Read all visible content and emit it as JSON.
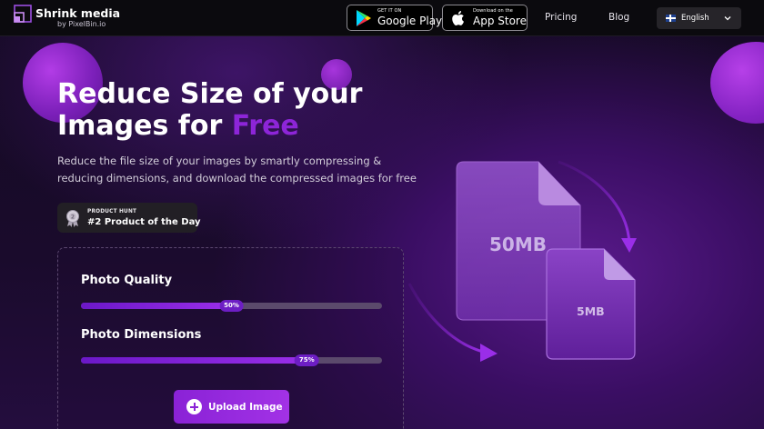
{
  "header": {
    "brand_name": "Shrink media",
    "brand_sub": "by PixelBin.io",
    "google_play": {
      "small": "GET IT ON",
      "big": "Google Play"
    },
    "app_store": {
      "small": "Download on the",
      "big": "App Store"
    },
    "nav": [
      {
        "label": "Pricing"
      },
      {
        "label": "Blog"
      }
    ],
    "language": {
      "selected": "English",
      "flag": "uk-flag-icon"
    }
  },
  "hero": {
    "title_line1": "Reduce Size of your",
    "title_line2_prefix": "Images for ",
    "title_highlight": "Free",
    "description": "Reduce the file size of your images by smartly compressing & reducing dimensions, and download the compressed images for free"
  },
  "badge": {
    "small": "PRODUCT HUNT",
    "big": "#2 Product of the Day",
    "icon": "medal-icon"
  },
  "controls": {
    "quality": {
      "label": "Photo Quality",
      "value": 50,
      "value_text": "50%"
    },
    "dimensions": {
      "label": "Photo Dimensions",
      "value": 75,
      "value_text": "75%"
    },
    "upload_label": "Upload Image"
  },
  "illustration": {
    "big_file": "50MB",
    "small_file": "5MB"
  },
  "colors": {
    "accent": "#8d25d8",
    "header_bg": "#0b0a0e",
    "slider_fill": "#7a1fd6"
  }
}
